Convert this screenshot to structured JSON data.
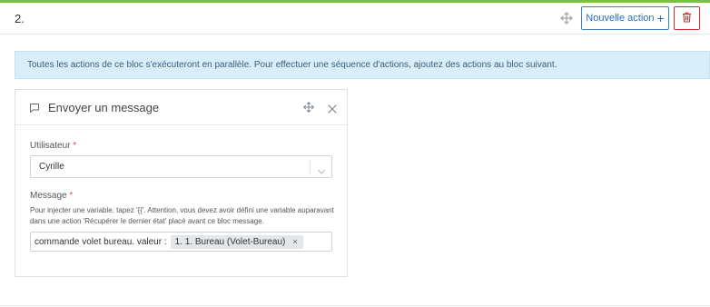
{
  "block": {
    "number": "2.",
    "new_action_label": "Nouvelle action",
    "new_action_icon": "plus-icon",
    "delete_icon": "trash-icon",
    "move_icon": "move-icon"
  },
  "info": {
    "text": "Toutes les actions de ce bloc s'exécuteront en parallèle. Pour effectuer une séquence d'actions, ajoutez des actions au bloc suivant."
  },
  "action": {
    "title": "Envoyer un message",
    "icon": "message-icon",
    "user_label": "Utilisateur",
    "required_mark": "*",
    "user_value": "Cyrille",
    "message_label": "Message",
    "message_help": "Pour injecter une variable, tapez '{{'. Attention, vous devez avoir défini une variable auparavant dans une action 'Récupérer le dernier état' placé avant ce bloc message.",
    "message_text": "commande volet bureau. valeur :",
    "variable_chip": "1. 1. Bureau (Volet-Bureau)",
    "chip_remove": "×"
  },
  "colors": {
    "accent_green": "#7ac143",
    "primary_blue": "#3b82c4",
    "danger_red": "#c9302c",
    "info_bg": "#d8eefa"
  }
}
